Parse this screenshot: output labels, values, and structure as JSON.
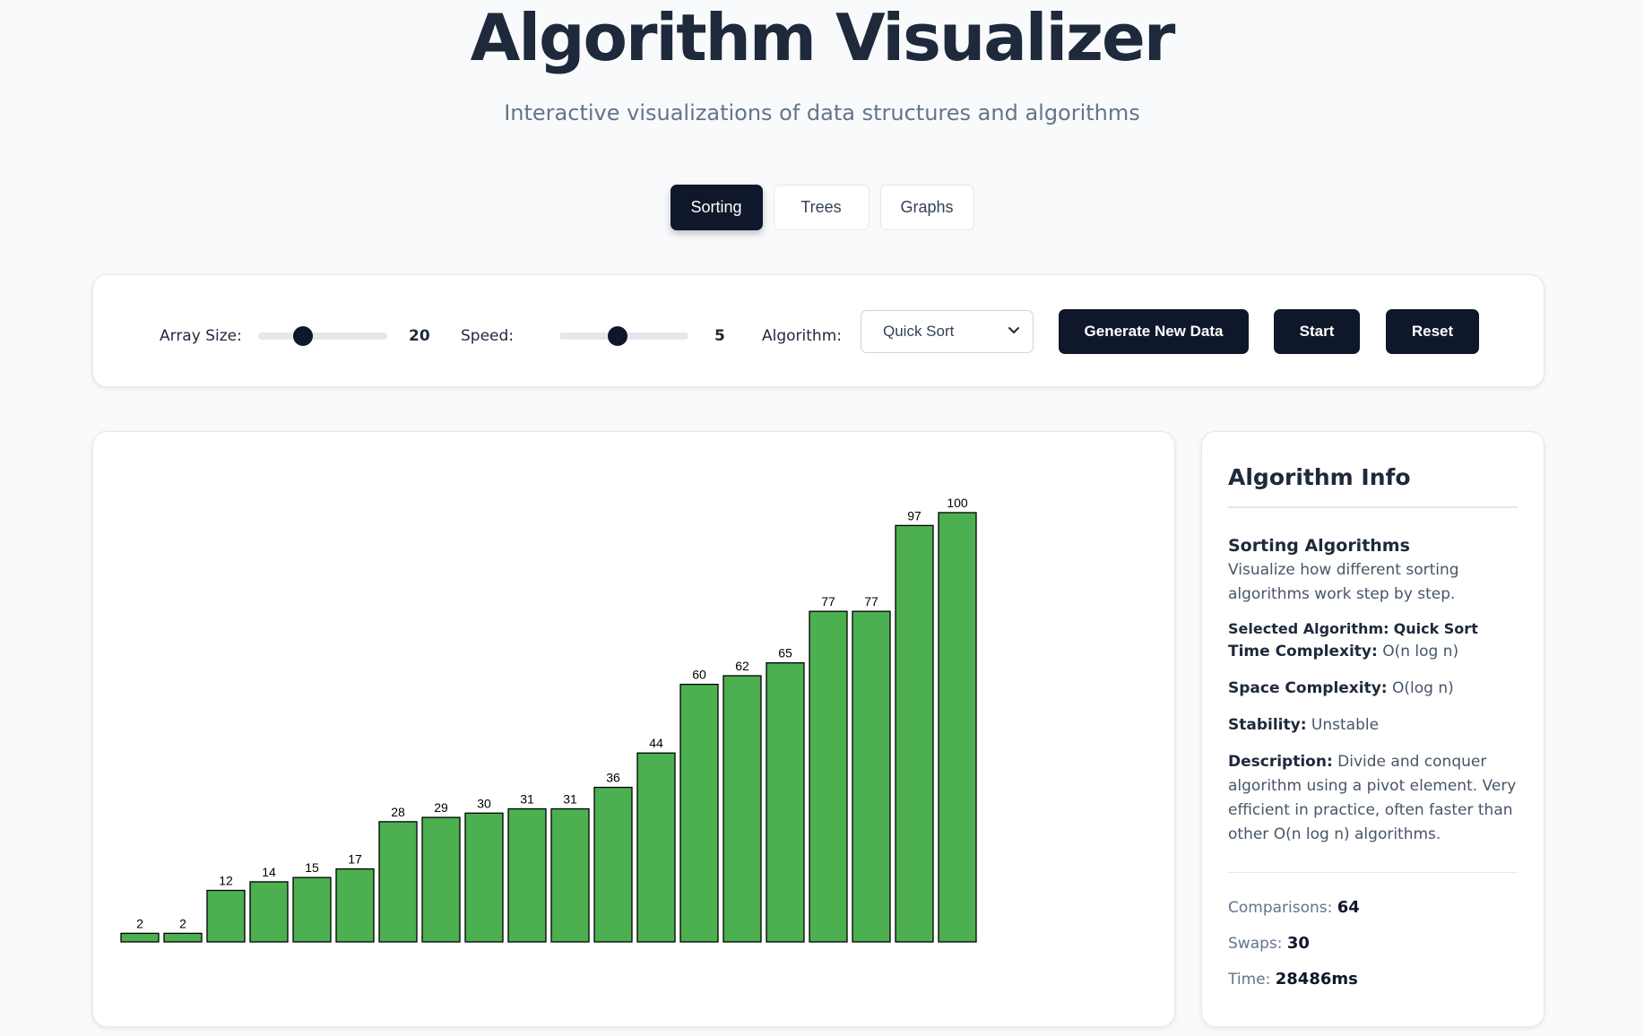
{
  "header": {
    "title": "Algorithm Visualizer",
    "subtitle": "Interactive visualizations of data structures and algorithms"
  },
  "tabs": [
    {
      "label": "Sorting",
      "active": true
    },
    {
      "label": "Trees",
      "active": false
    },
    {
      "label": "Graphs",
      "active": false
    }
  ],
  "controls": {
    "array_size_label": "Array Size:",
    "array_size_value": "20",
    "array_size_fraction": 0.35,
    "speed_label": "Speed:",
    "speed_value": "5",
    "speed_fraction": 0.45,
    "algorithm_label": "Algorithm:",
    "algorithm_selected": "Quick Sort",
    "generate_label": "Generate New Data",
    "start_label": "Start",
    "reset_label": "Reset"
  },
  "chart_data": {
    "type": "bar",
    "values": [
      2,
      2,
      12,
      14,
      15,
      17,
      28,
      29,
      30,
      31,
      31,
      36,
      44,
      60,
      62,
      65,
      77,
      77,
      97,
      100
    ],
    "bar_color": "#4caf50",
    "border_color": "#000000",
    "ylim": [
      0,
      100
    ]
  },
  "info": {
    "title": "Algorithm Info",
    "section_title": "Sorting Algorithms",
    "section_text": "Visualize how different sorting algorithms work step by step.",
    "selected_label": "Selected Algorithm:",
    "selected_value": "Quick Sort",
    "time_label": "Time Complexity:",
    "time_value": "O(n log n)",
    "space_label": "Space Complexity:",
    "space_value": "O(log n)",
    "stability_label": "Stability:",
    "stability_value": "Unstable",
    "description_label": "Description:",
    "description_value": "Divide and conquer algorithm using a pivot element. Very efficient in practice, often faster than other O(n log n) algorithms.",
    "comparisons_label": "Comparisons:",
    "comparisons_value": "64",
    "swaps_label": "Swaps:",
    "swaps_value": "30",
    "time_elapsed_label": "Time:",
    "time_elapsed_value": "28486ms"
  }
}
